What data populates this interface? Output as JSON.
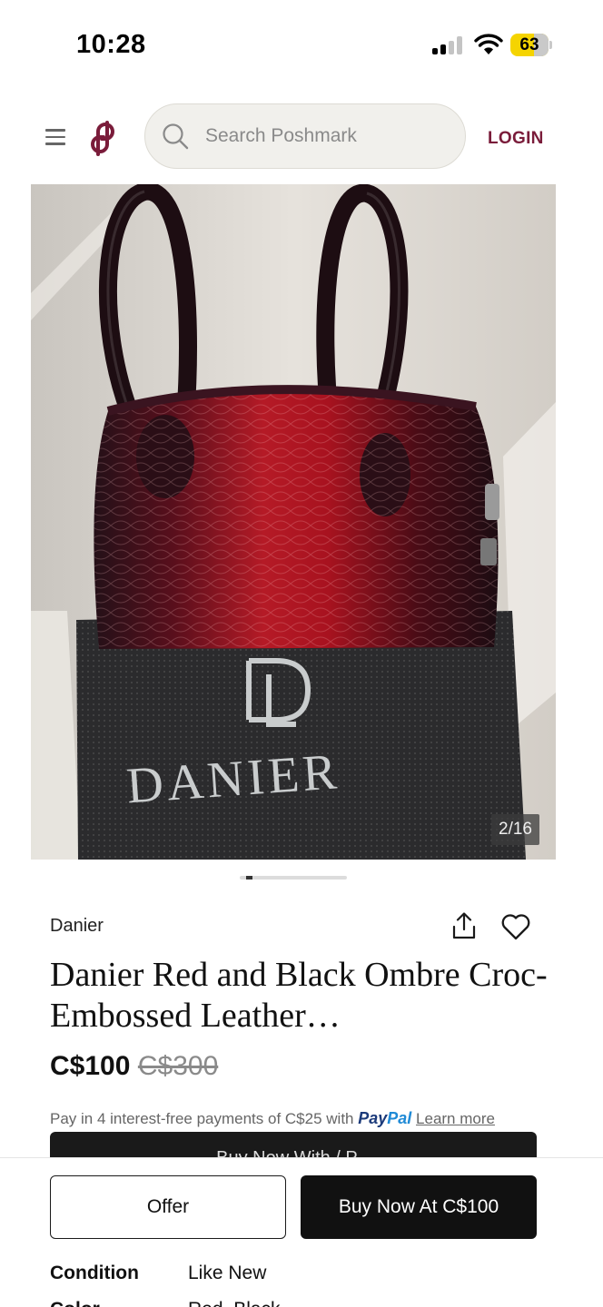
{
  "status_bar": {
    "time": "10:28",
    "battery_level": 63,
    "battery_text": "63",
    "battery_color": "#f5d400",
    "icons": [
      "cellular-signal-icon",
      "wifi-icon",
      "battery-icon"
    ]
  },
  "header": {
    "menu_icon": "hamburger-menu-icon",
    "logo_icon": "poshmark-logo-icon",
    "search": {
      "placeholder": "Search Poshmark",
      "value": ""
    },
    "login_label": "LOGIN",
    "accent_color": "#7a1c3a"
  },
  "gallery": {
    "counter": "2/16",
    "current_index": 2,
    "total": 16,
    "photo_text": "DANIER"
  },
  "listing": {
    "brand": "Danier",
    "title": "Danier Red and Black Ombre Croc-Embossed Leather…",
    "price": "C$100",
    "original_price": "C$300",
    "share_icon": "share-upload-icon",
    "like_icon": "heart-outline-icon"
  },
  "paypal": {
    "text": "Pay in 4 interest-free payments of C$25 with",
    "brand_part1": "Pay",
    "brand_part2": "Pal",
    "learn_more": "Learn more"
  },
  "peek_bar": {
    "text": "Buy Now With / P..."
  },
  "actions": {
    "offer_label": "Offer",
    "buy_label": "Buy Now At C$100"
  },
  "details": [
    {
      "key": "Condition",
      "value": "Like New"
    },
    {
      "key": "Color",
      "value": "Red, Black"
    }
  ]
}
